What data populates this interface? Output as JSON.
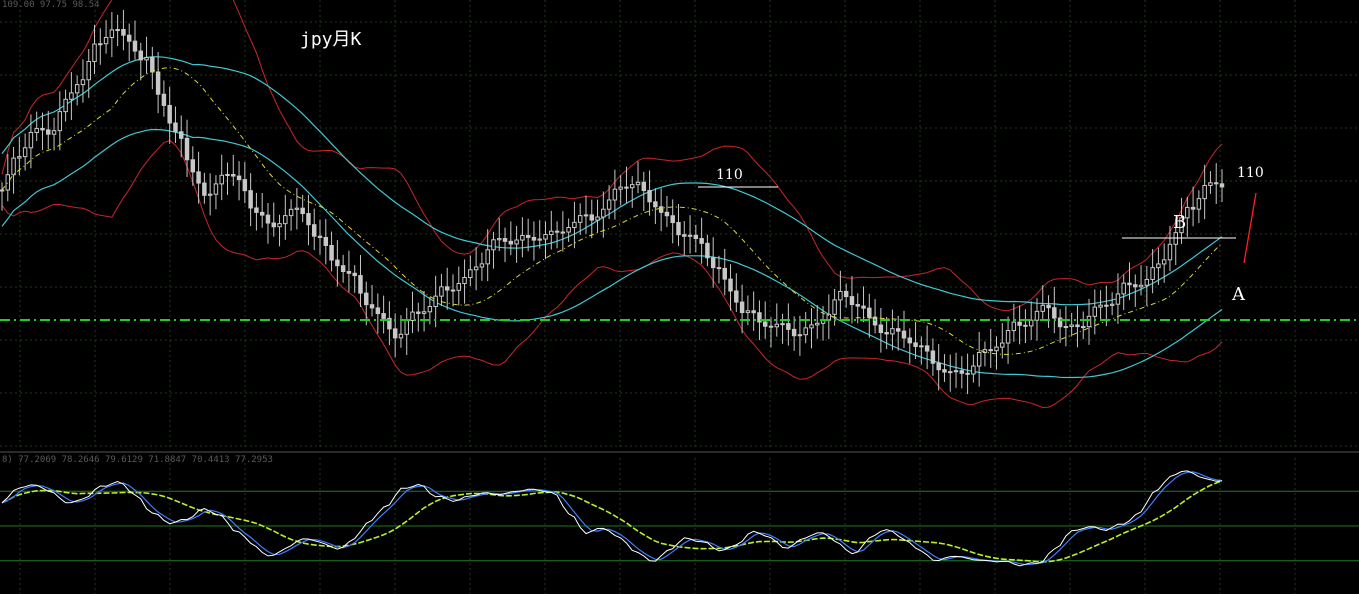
{
  "chart_data": {
    "type": "candlestick",
    "title": "jpy月K",
    "annotations": [
      {
        "text": "110",
        "target": "left-resistance"
      },
      {
        "text": "B",
        "target": "recent-high"
      },
      {
        "text": "A",
        "target": "recent-pullback"
      },
      {
        "text": "110",
        "target": "projection"
      }
    ],
    "indicator_header": "8) 77.2069 78.2646 79.6129 71.8847 70.4413 77.2953",
    "price_header": "109.00 97.75 98.54",
    "grid": true,
    "colors": {
      "background": "#000000",
      "grid": "#1c3a1c",
      "candle": "#c8c8c8",
      "bollinger": "#c8262a",
      "envelope": "#3fc7d2",
      "midline": "#d8d83a",
      "support": "#22cc22",
      "oscillator_fast": "#ffffff",
      "oscillator_slow": "#3d7fff",
      "oscillator_signal": "#b8f02a",
      "oscillator_levels": "#1f7a1f",
      "projection": "#ff2020"
    },
    "support_level": 110,
    "oscillator_levels": [
      80,
      50,
      20
    ],
    "price_path": [
      135,
      141,
      146,
      147,
      152,
      156,
      162,
      167,
      164,
      160,
      152,
      146,
      140,
      133,
      138,
      136,
      132,
      128,
      130,
      130,
      126,
      122,
      118,
      113,
      110,
      108,
      111,
      112,
      116,
      118,
      121,
      124,
      125,
      126,
      127,
      126,
      128,
      130,
      132,
      136,
      135,
      133,
      130,
      127,
      124,
      120,
      116,
      112,
      109,
      108,
      108,
      109,
      111,
      114,
      113,
      110,
      108,
      106,
      104,
      102,
      100,
      100,
      103,
      106,
      110,
      110,
      112,
      108,
      110,
      112,
      113,
      116,
      118,
      121,
      126,
      131,
      136,
      137
    ],
    "oscillator_path": [
      70,
      83,
      86,
      78,
      70,
      74,
      85,
      88,
      76,
      62,
      52,
      56,
      64,
      60,
      46,
      34,
      24,
      30,
      40,
      36,
      30,
      38,
      54,
      68,
      82,
      86,
      75,
      72,
      76,
      78,
      78,
      80,
      82,
      78,
      60,
      44,
      48,
      40,
      26,
      20,
      30,
      40,
      36,
      28,
      35,
      45,
      40,
      30,
      40,
      45,
      35,
      26,
      40,
      48,
      38,
      28,
      20,
      24,
      22,
      19,
      20,
      16,
      18,
      30,
      45,
      50,
      46,
      52,
      60,
      80,
      94,
      97,
      91,
      88
    ]
  }
}
